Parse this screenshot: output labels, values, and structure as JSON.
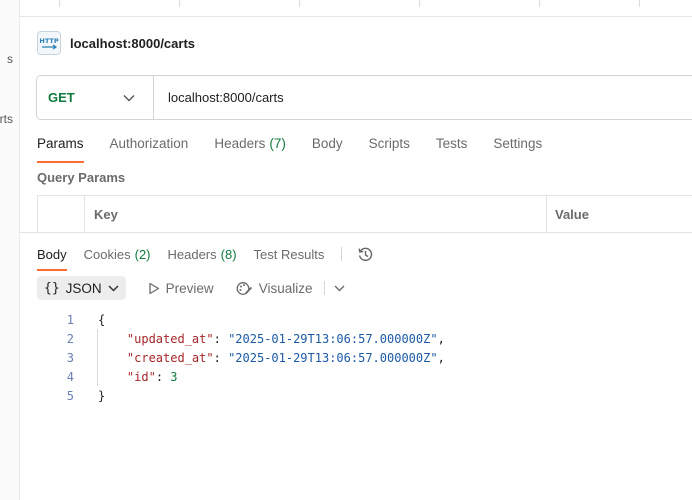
{
  "sidebar": {
    "fragments": [
      "s",
      "rts"
    ]
  },
  "request": {
    "title": "localhost:8000/carts",
    "method": "GET",
    "url": "localhost:8000/carts"
  },
  "request_tabs": [
    {
      "label": "Params",
      "count": ""
    },
    {
      "label": "Authorization",
      "count": ""
    },
    {
      "label": "Headers",
      "count": "(7)"
    },
    {
      "label": "Body",
      "count": ""
    },
    {
      "label": "Scripts",
      "count": ""
    },
    {
      "label": "Tests",
      "count": ""
    },
    {
      "label": "Settings",
      "count": ""
    }
  ],
  "query_params": {
    "label": "Query Params",
    "columns": [
      "Key",
      "Value"
    ]
  },
  "response_tabs": [
    {
      "label": "Body",
      "count": ""
    },
    {
      "label": "Cookies",
      "count": "(2)"
    },
    {
      "label": "Headers",
      "count": "(8)"
    },
    {
      "label": "Test Results",
      "count": ""
    }
  ],
  "response_toolbar": {
    "format": "JSON",
    "preview": "Preview",
    "visualize": "Visualize"
  },
  "response_body": {
    "line_numbers": [
      "1",
      "2",
      "3",
      "4",
      "5"
    ],
    "open": "{",
    "close": "}",
    "fields": [
      {
        "key": "\"updated_at\"",
        "value": "\"2025-01-29T13:06:57.000000Z\""
      },
      {
        "key": "\"created_at\"",
        "value": "\"2025-01-29T13:06:57.000000Z\""
      },
      {
        "key": "\"id\"",
        "value": "3"
      }
    ]
  },
  "colors": {
    "accent": "#ff6c37",
    "method_get": "#0f7b3e",
    "json_key": "#a6262a",
    "json_string": "#1c5aa6",
    "json_number": "#0f7b3e"
  }
}
